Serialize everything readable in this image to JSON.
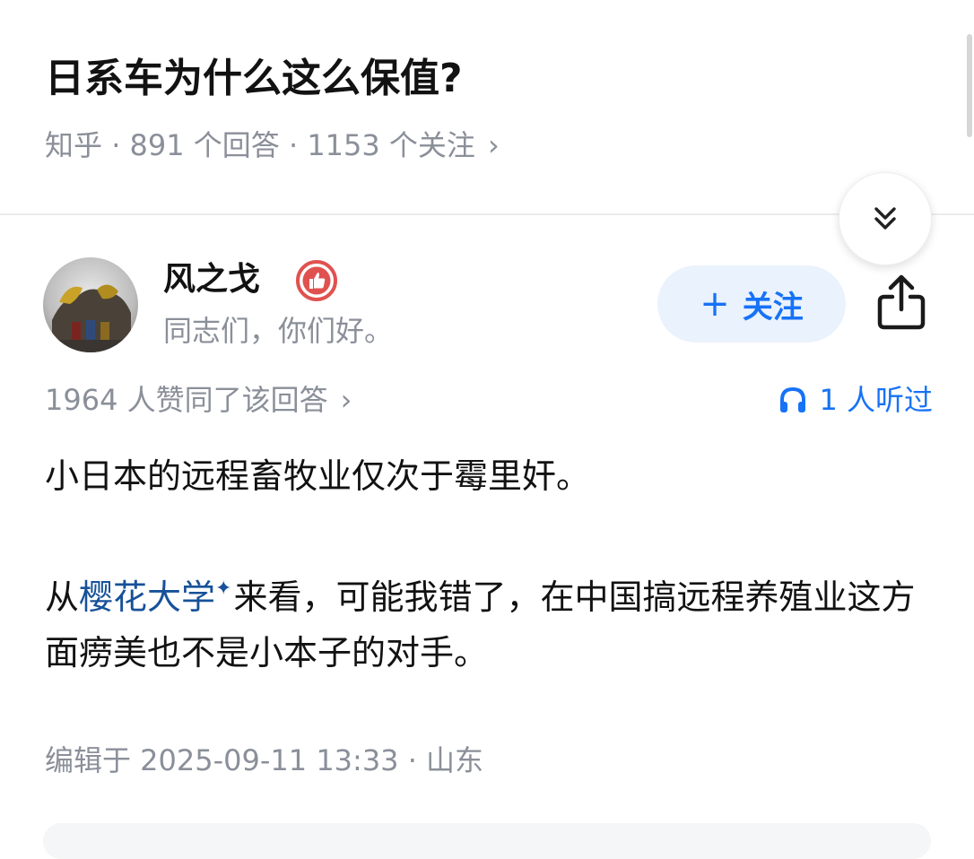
{
  "question": {
    "title": "日系车为什么这么保值?",
    "platform": "知乎",
    "answers_count": "891 个回答",
    "followers_count": "1153 个关注",
    "separator": " · ",
    "chevron": "›"
  },
  "author": {
    "name": "风之戈",
    "bio": "同志们，你们好。",
    "follow_plus": "+",
    "follow_label": "关注"
  },
  "stats": {
    "votes": "1964 人赞同了该回答",
    "chevron": "›",
    "listened": "1 人听过"
  },
  "answer": {
    "p1": "小日本的远程畜牧业仅次于霉里奸。",
    "p2_before": "从",
    "p2_link": "樱花大学",
    "p2_link_mark": "✦",
    "p2_after": "来看，可能我错了，在中国搞远程养殖业这方面痨美也不是小本子的对手。"
  },
  "footer": {
    "edited": "编辑于 2025-09-11 13:33 · 山东"
  },
  "icons": {
    "collapse": "double-chevron-down-icon",
    "badge": "thumbs-up-badge-icon",
    "share": "share-icon",
    "headphones": "headphones-icon"
  },
  "colors": {
    "accent": "#1772f6",
    "link": "#175199",
    "muted": "#8a8f99",
    "badge": "#e0524f",
    "follow_bg": "#eaf2fd"
  }
}
